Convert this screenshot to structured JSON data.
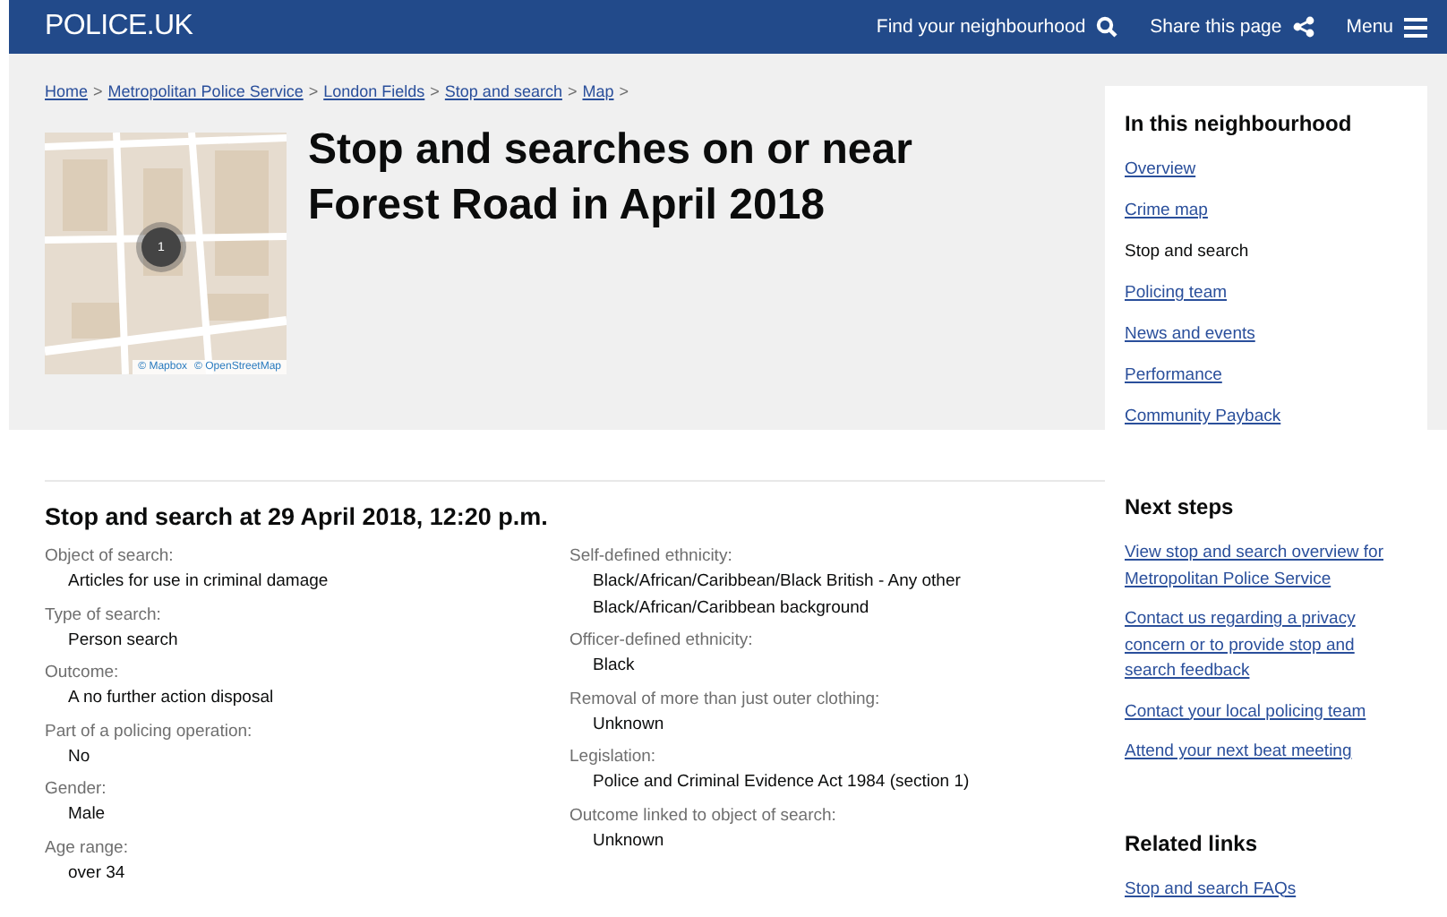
{
  "header": {
    "logo": "POLICE.UK",
    "actions": [
      {
        "kind": "search",
        "label": "Find your neighbourhood"
      },
      {
        "kind": "share",
        "label": "Share this page"
      },
      {
        "kind": "menu",
        "label": "Menu"
      }
    ]
  },
  "breadcrumb": [
    "Home",
    "Metropolitan Police Service",
    "London Fields",
    "Stop and search",
    "Map"
  ],
  "breadcrumb_separator": ">",
  "map": {
    "marker_count": "1",
    "attribution": [
      "© Mapbox",
      "© OpenStreetMap"
    ]
  },
  "title": "Stop and searches on or near Forest Road in April 2018",
  "neighbourhood_nav": {
    "heading": "In this neighbourhood",
    "items": [
      {
        "label": "Overview",
        "selected": false
      },
      {
        "label": "Crime map",
        "selected": false
      },
      {
        "label": "Stop and search",
        "selected": true
      },
      {
        "label": "Policing team",
        "selected": false
      },
      {
        "label": "News and events",
        "selected": false
      },
      {
        "label": "Performance",
        "selected": false
      },
      {
        "label": "Community Payback",
        "selected": false
      }
    ]
  },
  "record": {
    "heading": "Stop and search at 29 April 2018, 12:20 p.m.",
    "columns": [
      [
        {
          "label": "Object of search:",
          "value": "Articles for use in criminal damage"
        },
        {
          "label": "Type of search:",
          "value": "Person search"
        },
        {
          "label": "Outcome:",
          "value": "A no further action disposal"
        },
        {
          "label": "Part of a policing operation:",
          "value": "No"
        },
        {
          "label": "Gender:",
          "value": "Male"
        },
        {
          "label": "Age range:",
          "value": "over 34"
        }
      ],
      [
        {
          "label": "Self-defined ethnicity:",
          "value": "Black/African/Caribbean/Black British - Any other Black/African/Caribbean background"
        },
        {
          "label": "Officer-defined ethnicity:",
          "value": "Black"
        },
        {
          "label": "Removal of more than just outer clothing:",
          "value": "Unknown"
        },
        {
          "label": "Legislation:",
          "value": "Police and Criminal Evidence Act 1984 (section 1)"
        },
        {
          "label": "Outcome linked to object of search:",
          "value": "Unknown"
        }
      ]
    ]
  },
  "next_steps": {
    "heading": "Next steps",
    "links": [
      "View stop and search overview for Metropolitan Police Service",
      "Contact us regarding a privacy concern or to provide stop and search feedback",
      "Contact your local policing team",
      "Attend your next beat meeting"
    ]
  },
  "related_links": {
    "heading": "Related links",
    "links": [
      "Stop and search FAQs"
    ]
  }
}
